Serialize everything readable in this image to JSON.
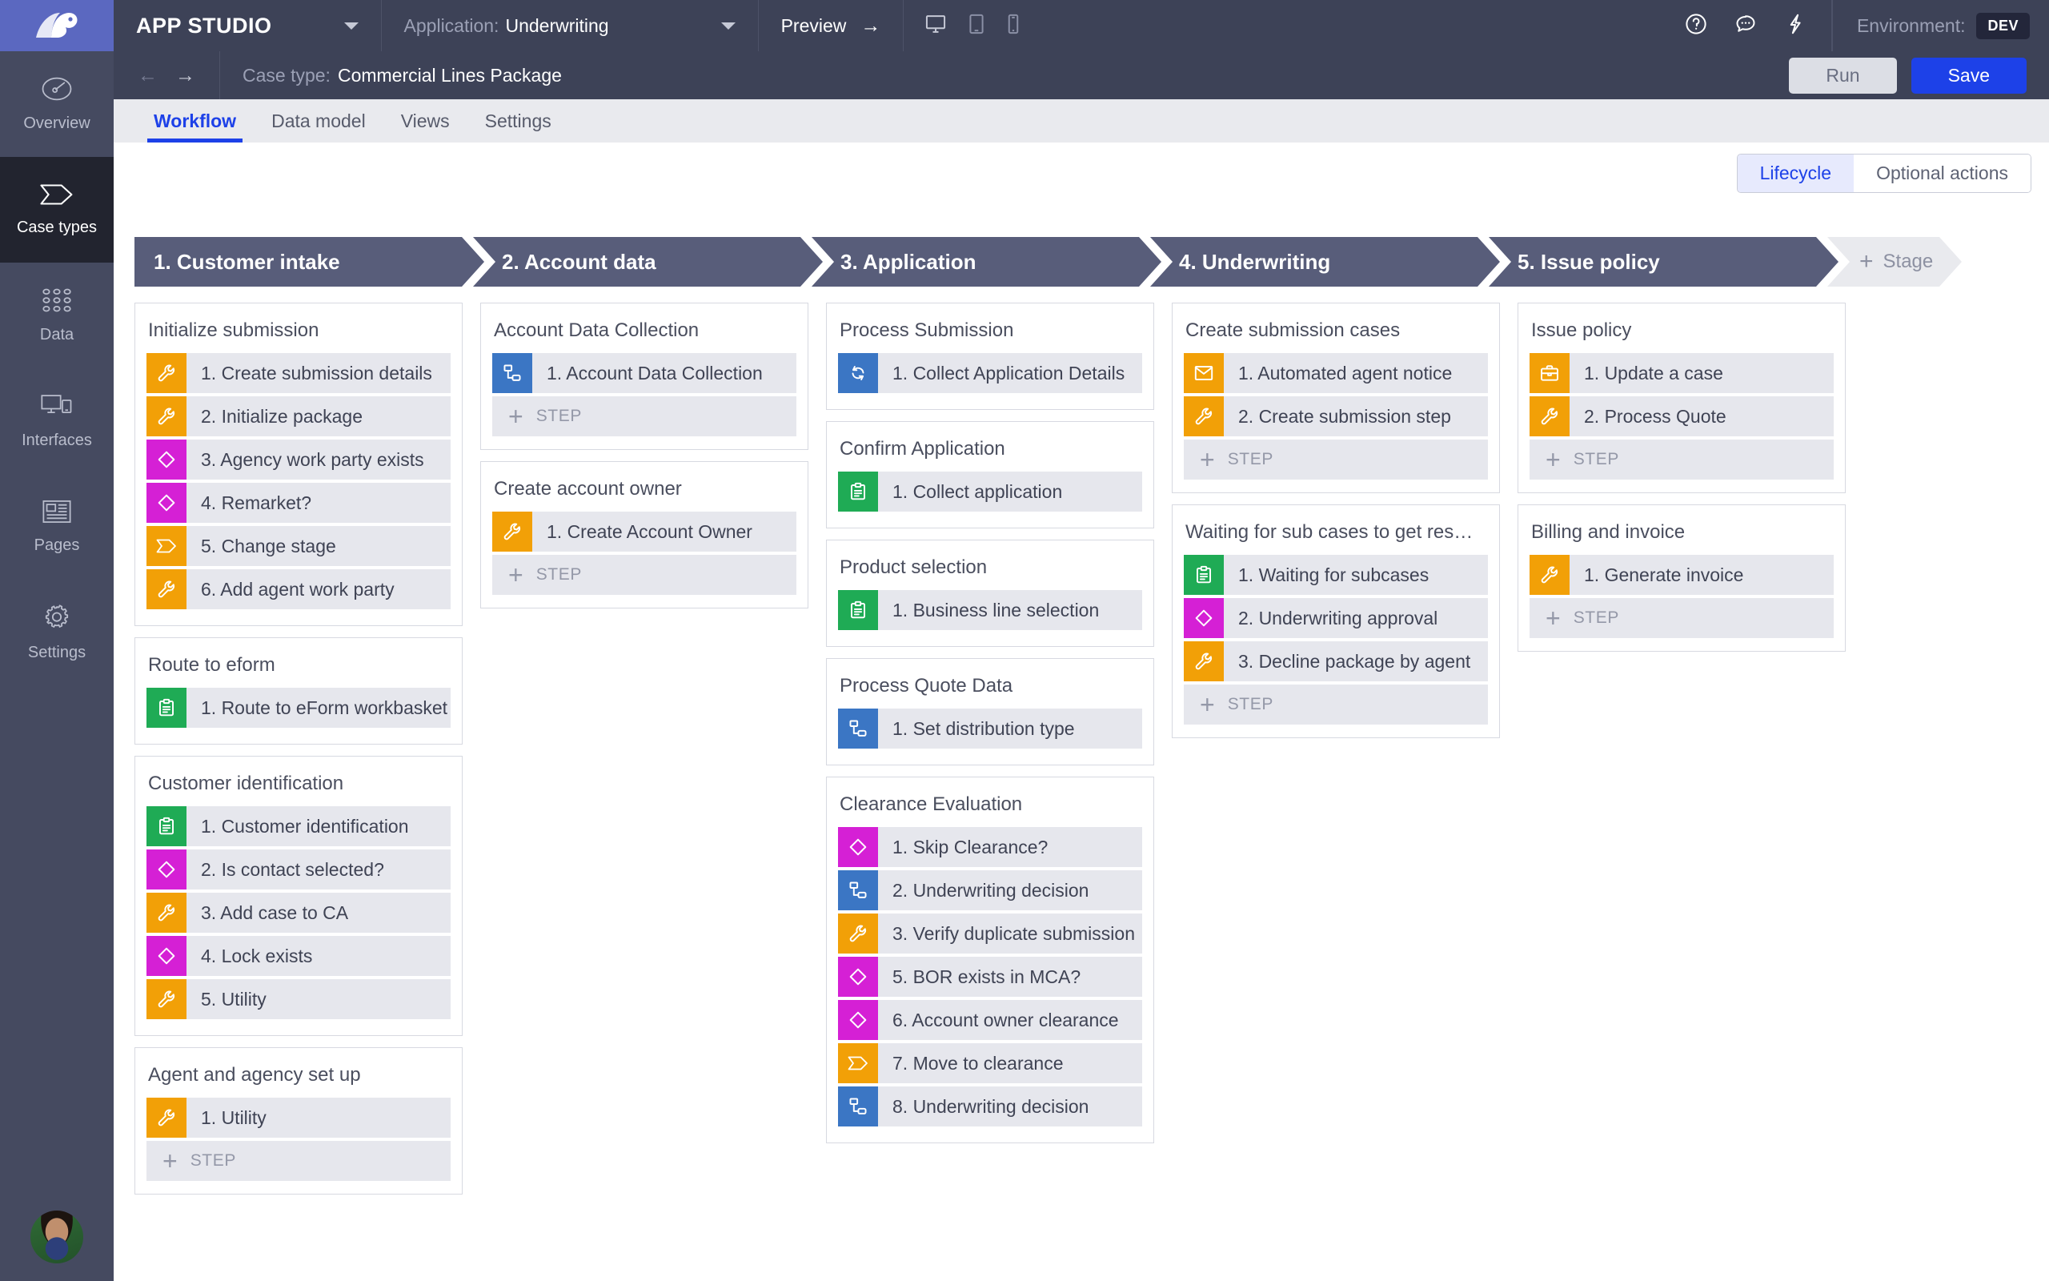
{
  "topbar": {
    "logo_icon": "pega-logo-icon",
    "app_studio": "APP STUDIO",
    "app_dropdown_icon": "chevron-down-icon",
    "application_label": "Application:",
    "application_value": "Underwriting",
    "application_dropdown_icon": "chevron-down-icon",
    "preview": "Preview",
    "preview_arrow_icon": "arrow-right-icon",
    "devices": [
      "desktop-icon",
      "tablet-icon",
      "phone-icon"
    ],
    "actions": [
      "help-icon",
      "chat-icon",
      "lightning-icon"
    ],
    "environment_label": "Environment:",
    "environment_value": "DEV"
  },
  "subbar": {
    "back_icon": "arrow-left-icon",
    "forward_icon": "arrow-right-icon",
    "case_type_label": "Case type:",
    "case_type_value": "Commercial Lines Package",
    "run_label": "Run",
    "save_label": "Save"
  },
  "rail": {
    "items": [
      {
        "label": "Overview",
        "icon": "gauge-icon",
        "active": false
      },
      {
        "label": "Case types",
        "icon": "case-chevron-icon",
        "active": true
      },
      {
        "label": "Data",
        "icon": "grid-dots-icon",
        "active": false
      },
      {
        "label": "Interfaces",
        "icon": "monitor-phone-icon",
        "active": false
      },
      {
        "label": "Pages",
        "icon": "article-icon",
        "active": false
      },
      {
        "label": "Settings",
        "icon": "gear-icon",
        "active": false
      }
    ],
    "avatar": "user-avatar"
  },
  "tabs": [
    {
      "label": "Workflow",
      "active": true
    },
    {
      "label": "Data model",
      "active": false
    },
    {
      "label": "Views",
      "active": false
    },
    {
      "label": "Settings",
      "active": false
    }
  ],
  "view_toggle": {
    "lifecycle": "Lifecycle",
    "optional_actions": "Optional actions",
    "selected": "Lifecycle"
  },
  "add_step_label": "STEP",
  "add_stage_label": "Stage",
  "colors": {
    "accent_blue": "#1d41e8",
    "stage_header": "#585d7a",
    "icon_orange": "#f2a007",
    "icon_magenta": "#d520d5",
    "icon_green": "#1fab55",
    "icon_blue": "#3b76c4",
    "topbar": "#3d4257",
    "logo_bg": "#5b68c0"
  },
  "stages": [
    {
      "title": "1. Customer intake"
    },
    {
      "title": "2. Account data"
    },
    {
      "title": "3. Application"
    },
    {
      "title": "4. Underwriting"
    },
    {
      "title": "5. Issue policy"
    }
  ],
  "columns": [
    {
      "processes": [
        {
          "title": "Initialize submission",
          "add_step": false,
          "steps": [
            {
              "label": "1. Create submission details",
              "icon": "wrench-icon",
              "color": "orange"
            },
            {
              "label": "2. Initialize package",
              "icon": "wrench-icon",
              "color": "orange"
            },
            {
              "label": "3. Agency work party exists",
              "icon": "decision-diamond-icon",
              "color": "magenta"
            },
            {
              "label": "4. Remarket?",
              "icon": "decision-diamond-icon",
              "color": "magenta"
            },
            {
              "label": "5. Change stage",
              "icon": "change-stage-icon",
              "color": "orange"
            },
            {
              "label": "6. Add agent work party",
              "icon": "wrench-icon",
              "color": "orange"
            }
          ]
        },
        {
          "title": "Route to eform",
          "add_step": false,
          "steps": [
            {
              "label": "1. Route to eForm workbasket",
              "icon": "clipboard-icon",
              "color": "green"
            }
          ]
        },
        {
          "title": "Customer identification",
          "add_step": false,
          "steps": [
            {
              "label": "1. Customer identification",
              "icon": "clipboard-icon",
              "color": "green"
            },
            {
              "label": "2. Is contact selected?",
              "icon": "decision-diamond-icon",
              "color": "magenta"
            },
            {
              "label": "3. Add case to CA",
              "icon": "wrench-icon",
              "color": "orange"
            },
            {
              "label": "4. Lock exists",
              "icon": "decision-diamond-icon",
              "color": "magenta"
            },
            {
              "label": "5. Utility",
              "icon": "wrench-icon",
              "color": "orange"
            }
          ]
        },
        {
          "title": "Agent and agency set up",
          "add_step": true,
          "steps": [
            {
              "label": "1. Utility",
              "icon": "wrench-icon",
              "color": "orange"
            }
          ]
        }
      ]
    },
    {
      "processes": [
        {
          "title": "Account Data Collection",
          "add_step": true,
          "steps": [
            {
              "label": "1. Account Data Collection",
              "icon": "subprocess-icon",
              "color": "blue"
            }
          ]
        },
        {
          "title": "Create account owner",
          "add_step": true,
          "steps": [
            {
              "label": "1. Create Account Owner",
              "icon": "wrench-icon",
              "color": "orange"
            }
          ]
        }
      ]
    },
    {
      "processes": [
        {
          "title": "Process Submission",
          "add_step": false,
          "steps": [
            {
              "label": "1. Collect Application Details",
              "icon": "loop-icon",
              "color": "blue"
            }
          ]
        },
        {
          "title": "Confirm Application",
          "add_step": false,
          "steps": [
            {
              "label": "1. Collect application",
              "icon": "clipboard-icon",
              "color": "green"
            }
          ]
        },
        {
          "title": "Product selection",
          "add_step": false,
          "steps": [
            {
              "label": "1. Business line selection",
              "icon": "clipboard-icon",
              "color": "green"
            }
          ]
        },
        {
          "title": "Process Quote Data",
          "add_step": false,
          "steps": [
            {
              "label": "1. Set distribution type",
              "icon": "subprocess-icon",
              "color": "blue"
            }
          ]
        },
        {
          "title": "Clearance Evaluation",
          "add_step": false,
          "steps": [
            {
              "label": "1. Skip Clearance?",
              "icon": "decision-diamond-icon",
              "color": "magenta"
            },
            {
              "label": "2. Underwriting decision",
              "icon": "subprocess-icon",
              "color": "blue"
            },
            {
              "label": "3. Verify duplicate submission",
              "icon": "wrench-icon",
              "color": "orange"
            },
            {
              "label": "5. BOR exists in MCA?",
              "icon": "decision-diamond-icon",
              "color": "magenta"
            },
            {
              "label": "6. Account owner clearance",
              "icon": "decision-diamond-icon",
              "color": "magenta"
            },
            {
              "label": "7. Move to clearance",
              "icon": "change-stage-icon",
              "color": "orange"
            },
            {
              "label": "8. Underwriting decision",
              "icon": "subprocess-icon",
              "color": "blue"
            }
          ]
        }
      ]
    },
    {
      "processes": [
        {
          "title": "Create submission cases",
          "add_step": true,
          "steps": [
            {
              "label": "1. Automated agent notice",
              "icon": "envelope-icon",
              "color": "orange"
            },
            {
              "label": "2. Create submission step",
              "icon": "wrench-icon",
              "color": "orange"
            }
          ]
        },
        {
          "title": "Waiting for sub cases to get res…",
          "add_step": true,
          "steps": [
            {
              "label": "1. Waiting for subcases",
              "icon": "clipboard-icon",
              "color": "green"
            },
            {
              "label": "2. Underwriting approval",
              "icon": "decision-diamond-icon",
              "color": "magenta"
            },
            {
              "label": "3. Decline package by agent",
              "icon": "wrench-icon",
              "color": "orange"
            }
          ]
        }
      ]
    },
    {
      "processes": [
        {
          "title": "Issue policy",
          "add_step": true,
          "steps": [
            {
              "label": "1. Update a case",
              "icon": "briefcase-icon",
              "color": "orange"
            },
            {
              "label": "2. Process Quote",
              "icon": "wrench-icon",
              "color": "orange"
            }
          ]
        },
        {
          "title": "Billing and invoice",
          "add_step": true,
          "steps": [
            {
              "label": "1. Generate invoice",
              "icon": "wrench-icon",
              "color": "orange"
            }
          ]
        }
      ]
    }
  ]
}
